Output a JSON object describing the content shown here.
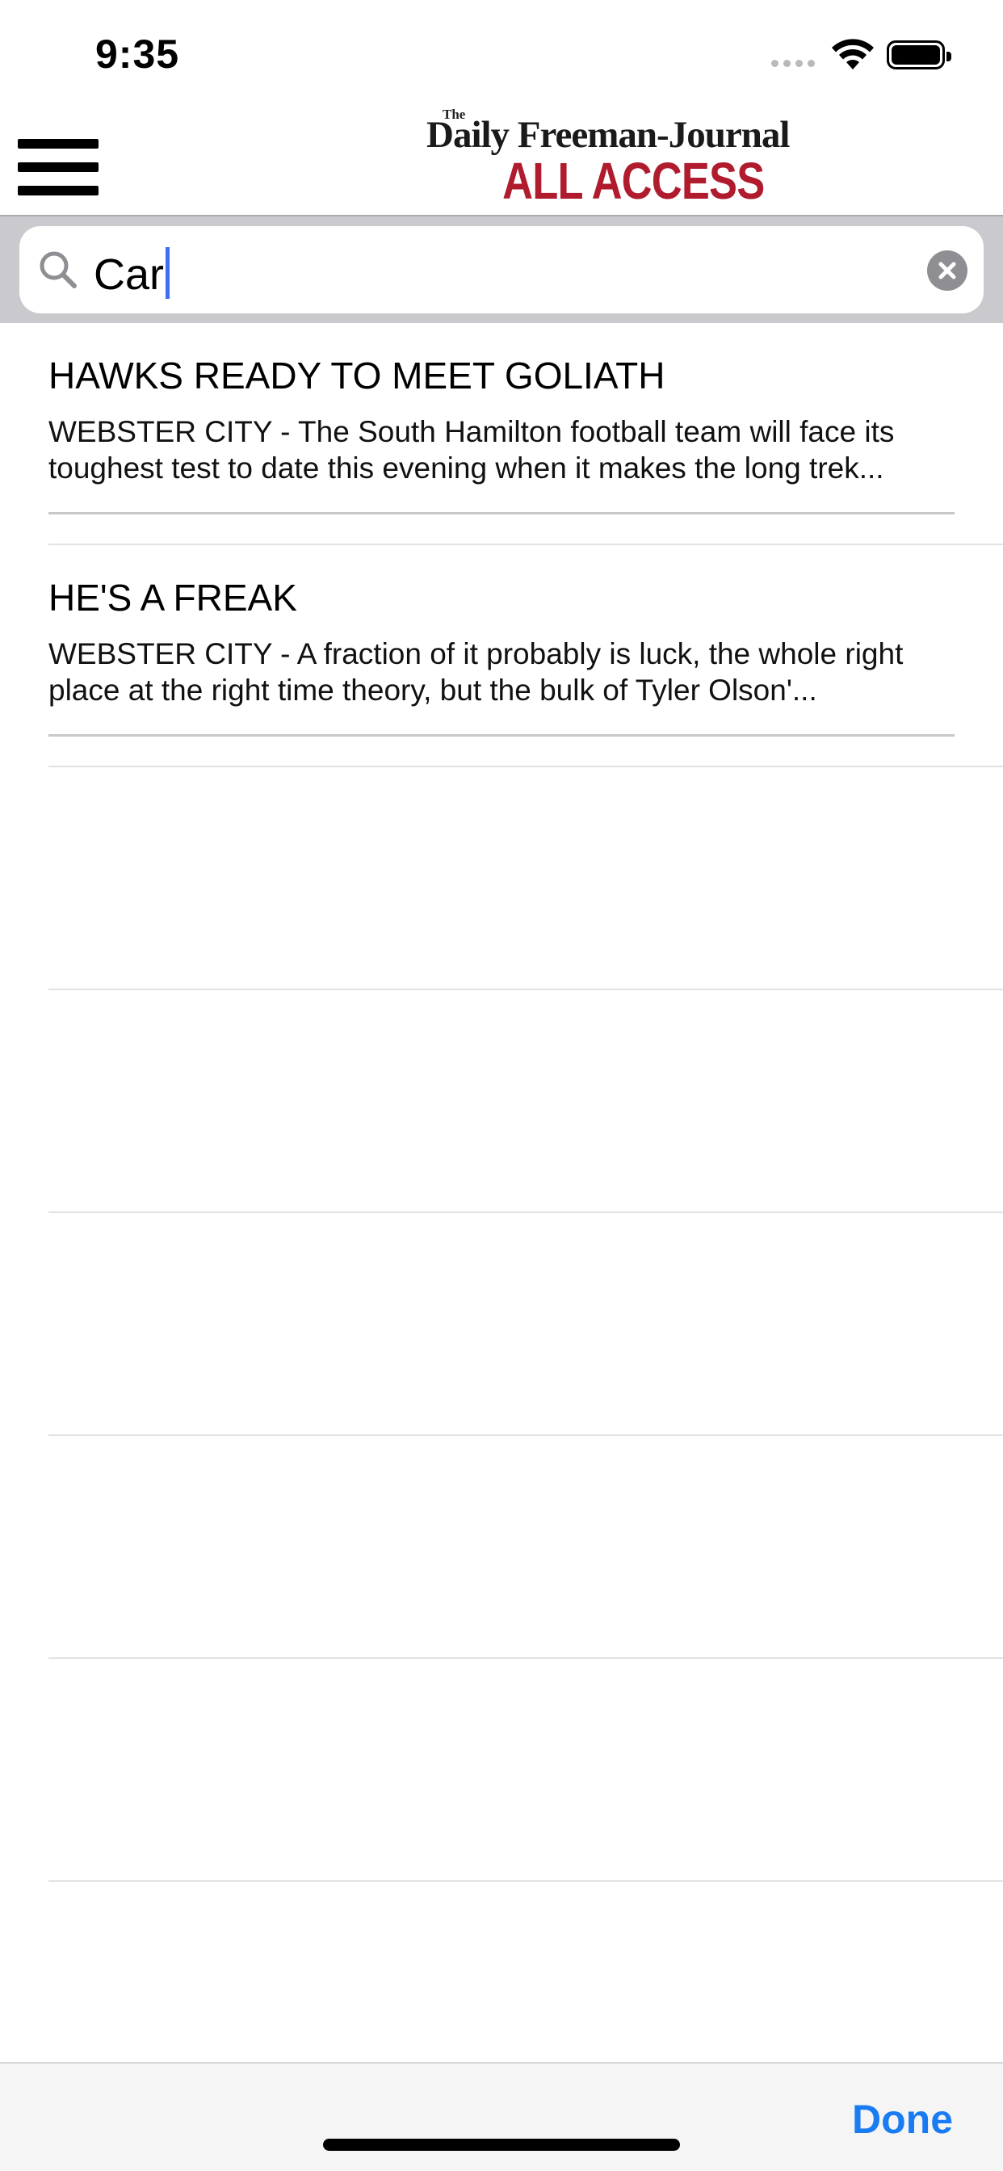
{
  "status_bar": {
    "time": "9:35"
  },
  "header": {
    "logo_prefix": "The",
    "logo_masthead": "Daily Freeman-Journal",
    "logo_accent": "ALL ACCESS",
    "accent_color": "#b01c2e"
  },
  "search": {
    "value": "Car",
    "search_icon": "search-icon",
    "clear_icon": "clear-icon"
  },
  "results": [
    {
      "title": "HAWKS READY TO MEET GOLIATH",
      "summary": "WEBSTER CITY - The South Hamilton football team will face its toughest test to date this evening when it makes the long trek..."
    },
    {
      "title": "HE'S A FREAK",
      "summary": "WEBSTER CITY - A fraction of it probably is luck, the whole right place at the right time theory, but the bulk of Tyler Olson'..."
    }
  ],
  "toolbar": {
    "done_label": "Done",
    "accent_color": "#1a7cf2"
  }
}
